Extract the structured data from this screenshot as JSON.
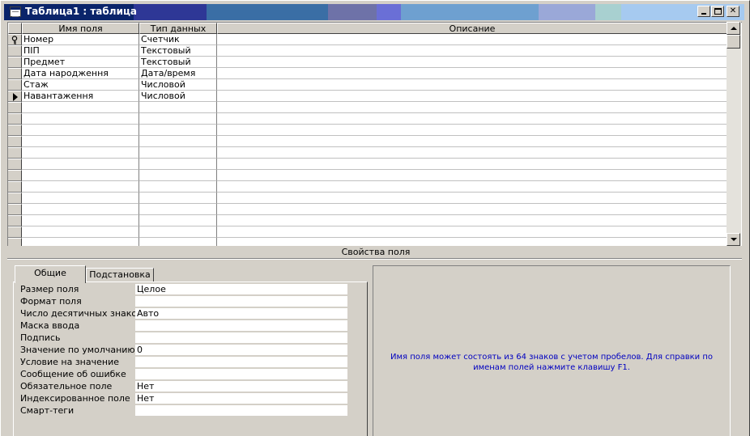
{
  "window": {
    "title": "Таблица1 : таблица",
    "title_bar_colors": [
      "#0a246a",
      "#2e3796",
      "#3a6ea5",
      "#6e72a8",
      "#6a6fd6",
      "#6ea0d0",
      "#9aa8d8",
      "#a8d0d0",
      "#a6caf0"
    ],
    "controls": {
      "minimize": "minimize-icon",
      "maximize": "maximize-icon",
      "close": "✕"
    }
  },
  "grid": {
    "columns": [
      "Имя поля",
      "Тип данных",
      "Описание"
    ],
    "rows": [
      {
        "name": "Номер",
        "type": "Счетчик",
        "description": "",
        "marker": "key-icon"
      },
      {
        "name": "ПІП",
        "type": "Текстовый",
        "description": "",
        "marker": ""
      },
      {
        "name": "Предмет",
        "type": "Текстовый",
        "description": "",
        "marker": ""
      },
      {
        "name": "Дата народження",
        "type": "Дата/время",
        "description": "",
        "marker": ""
      },
      {
        "name": "Стаж",
        "type": "Числовой",
        "description": "",
        "marker": ""
      },
      {
        "name": "Навантаження",
        "type": "Числовой",
        "description": "",
        "marker": "current-row-arrow-icon"
      }
    ]
  },
  "properties": {
    "section_label": "Свойства поля",
    "tabs": [
      {
        "label": "Общие",
        "active": true
      },
      {
        "label": "Подстановка",
        "active": false
      }
    ],
    "fields": [
      {
        "label": "Размер поля",
        "value": "Целое"
      },
      {
        "label": "Формат поля",
        "value": ""
      },
      {
        "label": "Число десятичных знаков",
        "value": "Авто"
      },
      {
        "label": "Маска ввода",
        "value": ""
      },
      {
        "label": "Подпись",
        "value": ""
      },
      {
        "label": "Значение по умолчанию",
        "value": "0"
      },
      {
        "label": "Условие на значение",
        "value": ""
      },
      {
        "label": "Сообщение об ошибке",
        "value": ""
      },
      {
        "label": "Обязательное поле",
        "value": "Нет"
      },
      {
        "label": "Индексированное поле",
        "value": "Нет"
      },
      {
        "label": "Смарт-теги",
        "value": ""
      }
    ],
    "help_text": "Имя поля может состоять из 64 знаков с учетом пробелов.  Для справки по именам полей нажмите клавишу F1.",
    "help_text_color": "#0000c0"
  }
}
